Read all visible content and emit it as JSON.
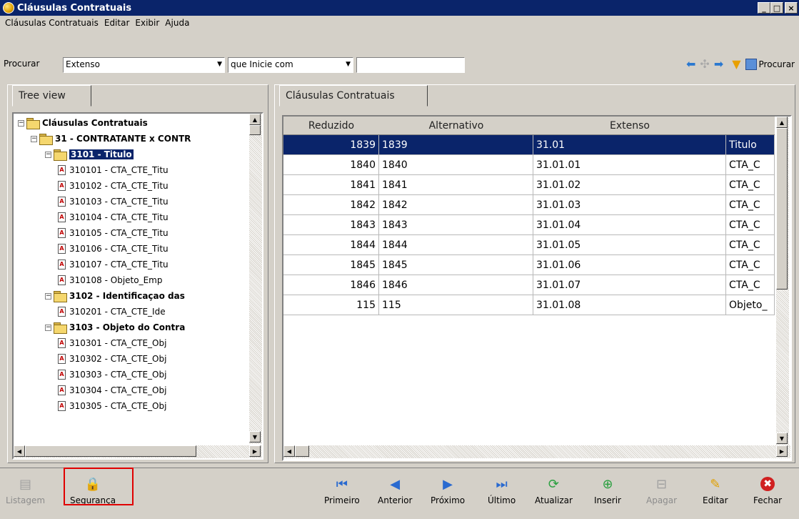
{
  "window": {
    "title": "Cláusulas Contratuais"
  },
  "menu": [
    "Cláusulas Contratuais",
    "Editar",
    "Exibir",
    "Ajuda"
  ],
  "search": {
    "label": "Procurar",
    "field_value": "Extenso",
    "condition_value": "que Inicie com",
    "text_value": "",
    "button_label": "Procurar"
  },
  "left_tab": "Tree view",
  "right_tab": "Cláusulas Contratuais",
  "tree": [
    {
      "label": "Cláusulas Contratuais",
      "type": "folder",
      "bold": true
    },
    {
      "label": "31 - CONTRATANTE x CONTR",
      "type": "folder",
      "bold": true
    },
    {
      "label": "3101 - Titulo",
      "type": "folder-open",
      "bold": true,
      "selected": true
    },
    {
      "label": "310101 - CTA_CTE_Titu",
      "type": "doc"
    },
    {
      "label": "310102 - CTA_CTE_Titu",
      "type": "doc"
    },
    {
      "label": "310103 - CTA_CTE_Titu",
      "type": "doc"
    },
    {
      "label": "310104 - CTA_CTE_Titu",
      "type": "doc"
    },
    {
      "label": "310105 - CTA_CTE_Titu",
      "type": "doc"
    },
    {
      "label": "310106 - CTA_CTE_Titu",
      "type": "doc"
    },
    {
      "label": "310107 - CTA_CTE_Titu",
      "type": "doc"
    },
    {
      "label": "310108 - Objeto_Emp",
      "type": "doc"
    },
    {
      "label": "3102 - Identificaçao das",
      "type": "folder",
      "bold": true
    },
    {
      "label": "310201 - CTA_CTE_Ide",
      "type": "doc"
    },
    {
      "label": "3103 - Objeto do Contra",
      "type": "folder",
      "bold": true
    },
    {
      "label": "310301 - CTA_CTE_Obj",
      "type": "doc"
    },
    {
      "label": "310302 - CTA_CTE_Obj",
      "type": "doc"
    },
    {
      "label": "310303 - CTA_CTE_Obj",
      "type": "doc"
    },
    {
      "label": "310304 - CTA_CTE_Obj",
      "type": "doc"
    },
    {
      "label": "310305 - CTA_CTE_Obj",
      "type": "doc"
    }
  ],
  "grid": {
    "columns": [
      "Reduzido",
      "Alternativo",
      "Extenso",
      ""
    ],
    "rows": [
      [
        "1839",
        "1839",
        "31.01",
        "Titulo"
      ],
      [
        "1840",
        "1840",
        "31.01.01",
        "CTA_C"
      ],
      [
        "1841",
        "1841",
        "31.01.02",
        "CTA_C"
      ],
      [
        "1842",
        "1842",
        "31.01.03",
        "CTA_C"
      ],
      [
        "1843",
        "1843",
        "31.01.04",
        "CTA_C"
      ],
      [
        "1844",
        "1844",
        "31.01.05",
        "CTA_C"
      ],
      [
        "1845",
        "1845",
        "31.01.06",
        "CTA_C"
      ],
      [
        "1846",
        "1846",
        "31.01.07",
        "CTA_C"
      ],
      [
        "115",
        "115",
        "31.01.08",
        "Objeto_"
      ]
    ]
  },
  "toolbar": {
    "listagem": "Listagem",
    "seguranca": "Segurança",
    "primeiro": "Primeiro",
    "anterior": "Anterior",
    "proximo": "Próximo",
    "ultimo": "Último",
    "atualizar": "Atualizar",
    "inserir": "Inserir",
    "apagar": "Apagar",
    "editar": "Editar",
    "fechar": "Fechar"
  },
  "colors": {
    "title_bar": "#0a246a",
    "selection": "#0a246a",
    "highlight_box": "#e00000"
  }
}
